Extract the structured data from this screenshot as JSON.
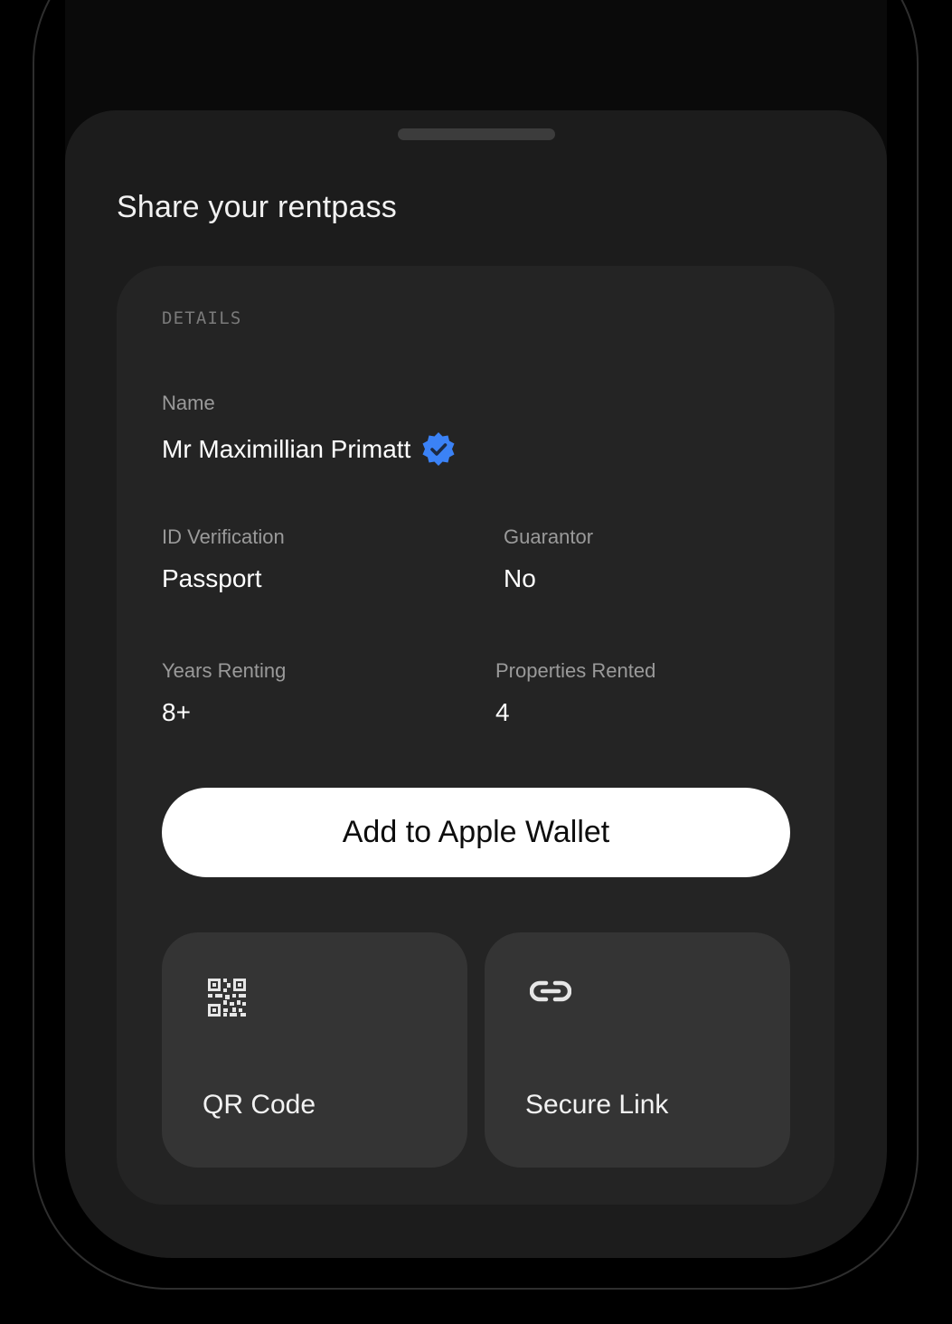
{
  "sheet": {
    "title": "Share your rentpass"
  },
  "details": {
    "section_label": "DETAILS",
    "name_label": "Name",
    "name_value": "Mr Maximillian Primatt",
    "verified_badge_color": "#3b82f6",
    "id_verification_label": "ID Verification",
    "id_verification_value": "Passport",
    "guarantor_label": "Guarantor",
    "guarantor_value": "No",
    "years_renting_label": "Years Renting",
    "years_renting_value": "8+",
    "properties_rented_label": "Properties Rented",
    "properties_rented_value": "4"
  },
  "actions": {
    "wallet_label": "Add to Apple Wallet",
    "qr_label": "QR Code",
    "qr_icon": "qr-code-icon",
    "link_label": "Secure Link",
    "link_icon": "link-icon"
  },
  "colors": {
    "background": "#000000",
    "sheet": "#1c1c1c",
    "card": "#242424",
    "tile": "#343434",
    "button": "#ffffff",
    "accent": "#3b82f6"
  }
}
